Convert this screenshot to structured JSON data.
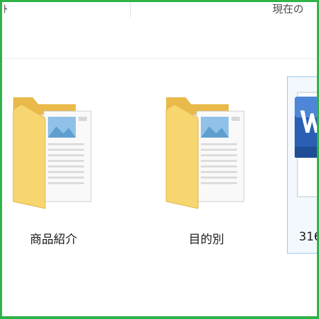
{
  "header": {
    "column_left": "ﾄ",
    "column_right": "現在の"
  },
  "items": [
    {
      "label": "商品紹介",
      "icon": "folder-icon"
    },
    {
      "label": "目的別",
      "icon": "folder-icon"
    },
    {
      "label": "316",
      "icon": "word-document-icon"
    }
  ],
  "colors": {
    "frame_border": "#2db34a",
    "selection_fill": "#f2f8fd",
    "selection_border": "#99c9ef",
    "folder_yellow": "#f5d06b",
    "word_blue": "#2b5fb4"
  }
}
